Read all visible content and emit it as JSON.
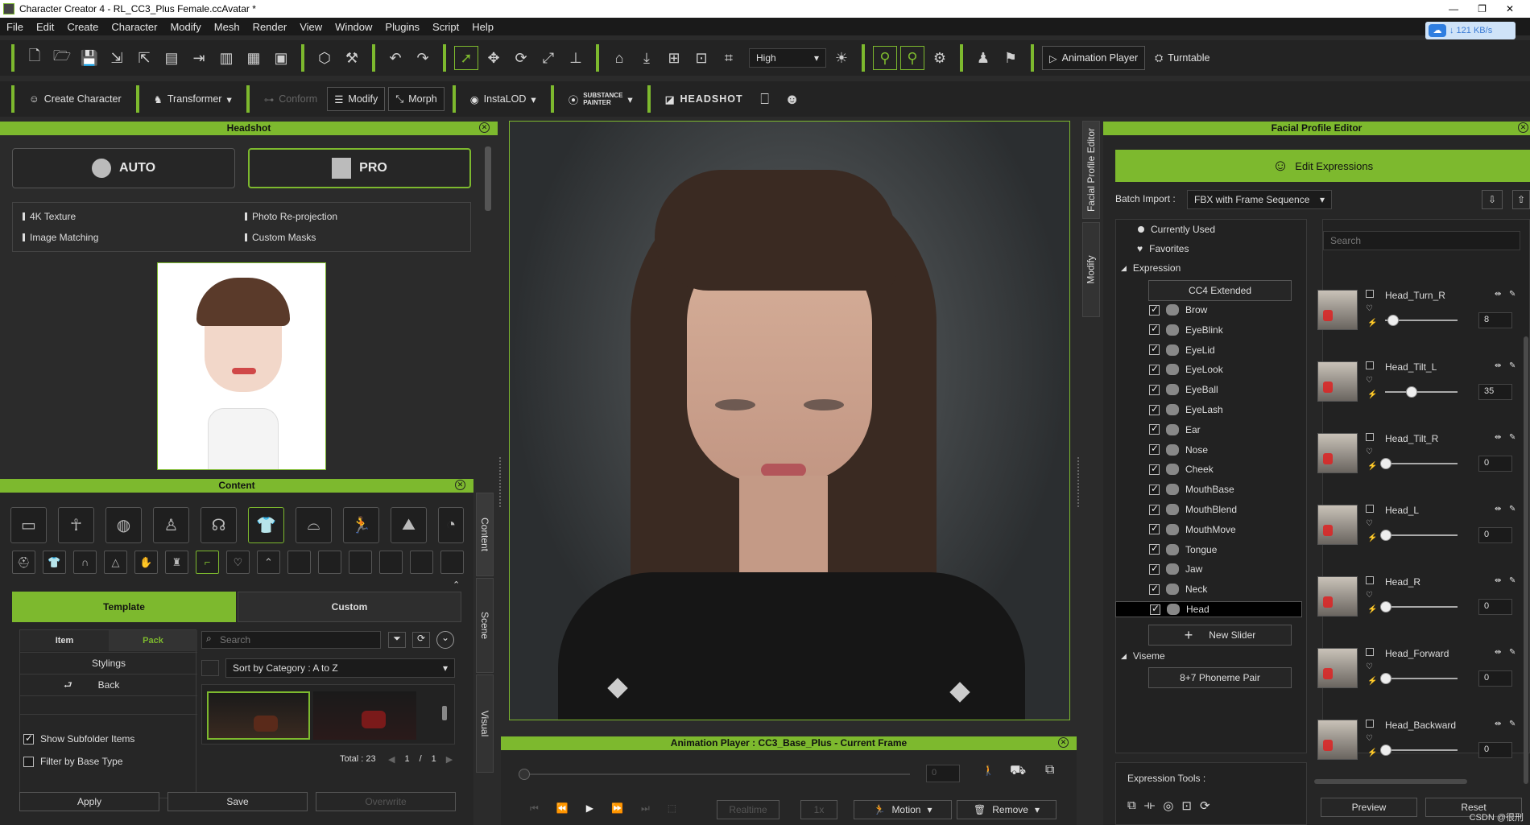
{
  "window": {
    "title": "Character Creator 4 - RL_CC3_Plus Female.ccAvatar *",
    "minimize": "—",
    "restore": "❐",
    "close": "✕"
  },
  "menu": [
    "File",
    "Edit",
    "Create",
    "Character",
    "Modify",
    "Mesh",
    "Render",
    "View",
    "Window",
    "Plugins",
    "Script",
    "Help"
  ],
  "net": {
    "speed": "↓ 121 KB/s"
  },
  "toolbar1": {
    "quality": "High",
    "animation_player": "Animation Player",
    "turntable": "Turntable"
  },
  "toolbar2": {
    "create_character": "Create Character",
    "transformer": "Transformer",
    "conform": "Conform",
    "modify": "Modify",
    "morph": "Morph",
    "instalod": "InstaLOD",
    "substance_1": "SUBSTANCE",
    "substance_2": "PAINTER",
    "headshot": "HEADSHOT"
  },
  "headshot": {
    "title": "Headshot",
    "auto": "AUTO",
    "pro": "PRO",
    "features": [
      "4K Texture",
      "Photo Re-projection",
      "Image Matching",
      "Custom Masks"
    ]
  },
  "content": {
    "title": "Content",
    "tabs": [
      "Template",
      "Custom"
    ],
    "subtabs": [
      "Item",
      "Pack"
    ],
    "search_placeholder": "Search",
    "sort": "Sort by Category : A to Z",
    "list": [
      "Stylings",
      "Back"
    ],
    "show_subfolder": "Show Subfolder Items",
    "filter_base": "Filter by Base Type",
    "total": "Total : 23",
    "page_cur": "1",
    "page_sep": "/",
    "page_total": "1",
    "apply": "Apply",
    "save": "Save",
    "overwrite": "Overwrite"
  },
  "side_tabs": {
    "content": "Content",
    "scene": "Scene",
    "visual": "Visual"
  },
  "anim": {
    "title": "Animation Player : CC3_Base_Plus - Current Frame",
    "frame": "0",
    "realtime": "Realtime",
    "speed": "1x",
    "motion": "Motion",
    "remove": "Remove"
  },
  "vert_tabs": {
    "fpe": "Facial Profile Editor",
    "modify": "Modify"
  },
  "fpe": {
    "title": "Facial Profile Editor",
    "edit_expressions": "Edit Expressions",
    "batch_label": "Batch Import :",
    "batch_value": "FBX with Frame Sequence",
    "search_placeholder": "Search",
    "currently_used": "Currently Used",
    "favorites": "Favorites",
    "expression": "Expression",
    "cc4_extended": "CC4 Extended",
    "items": [
      "Brow",
      "EyeBlink",
      "EyeLid",
      "EyeLook",
      "EyeBall",
      "EyeLash",
      "Ear",
      "Nose",
      "Cheek",
      "MouthBase",
      "MouthBlend",
      "MouthMove",
      "Tongue",
      "Jaw",
      "Neck",
      "Head"
    ],
    "new_slider": "New Slider",
    "viseme": "Viseme",
    "phoneme": "8+7 Phoneme Pair",
    "expression_tools": "Expression Tools :",
    "preview": "Preview",
    "reset": "Reset",
    "watermark": "CSDN @很刑",
    "sliders": [
      {
        "name": "Head_Turn_R",
        "value": "8",
        "level": 0.1
      },
      {
        "name": "Head_Tilt_L",
        "value": "35",
        "level": 0.35
      },
      {
        "name": "Head_Tilt_R",
        "value": "0",
        "level": 0
      },
      {
        "name": "Head_L",
        "value": "0",
        "level": 0
      },
      {
        "name": "Head_R",
        "value": "0",
        "level": 0
      },
      {
        "name": "Head_Forward",
        "value": "0",
        "level": 0
      },
      {
        "name": "Head_Backward",
        "value": "0",
        "level": 0
      }
    ]
  },
  "colors": {
    "accent": "#7db92e"
  }
}
